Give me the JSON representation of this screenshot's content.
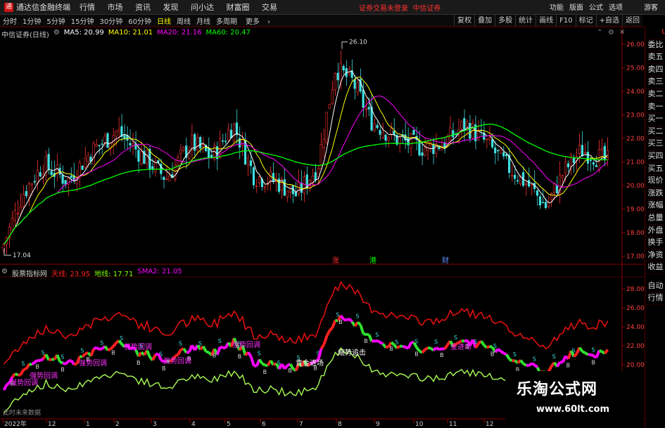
{
  "app": {
    "title": "通达信金融终端",
    "menu": [
      "行情",
      "市场",
      "资讯",
      "发现",
      "问小达",
      "财富圈",
      "交易"
    ],
    "notice": "证券交易未登录",
    "broker": "中信证券",
    "right_menu": [
      "功能",
      "版面",
      "公式",
      "选项"
    ],
    "guest": "游客"
  },
  "periods": [
    "分时",
    "1分钟",
    "5分钟",
    "15分钟",
    "30分钟",
    "60分钟",
    "日线",
    "周线",
    "月线",
    "多周期",
    "更多"
  ],
  "active_period": "日线",
  "toolbar": [
    "复权",
    "叠加",
    "多股",
    "统计",
    "画线",
    "F10",
    "标记",
    "+自选",
    "返回"
  ],
  "right_panel": [
    "委比",
    "卖五",
    "卖四",
    "卖三",
    "卖二",
    "卖一",
    "买一",
    "买二",
    "买三",
    "买四",
    "买五",
    "现价",
    "涨跌",
    "涨幅",
    "总量",
    "外盘",
    "换手",
    "净资",
    "收益"
  ],
  "right_panel_bottom": [
    "自动",
    "行情"
  ],
  "right_panel_top": "L",
  "main_chart": {
    "stock": "中信证券(日线)",
    "ma": [
      {
        "label": "MA5: 20.99",
        "color": "#ffffff"
      },
      {
        "label": "MA10: 21.01",
        "color": "#ffff00"
      },
      {
        "label": "MA20: 21.16",
        "color": "#ff00ff"
      },
      {
        "label": "MA60: 20.47",
        "color": "#00ff00"
      }
    ],
    "y_ticks": [
      "26.00",
      "25.00",
      "24.00",
      "23.00",
      "22.00",
      "21.00",
      "20.00",
      "19.00",
      "18.00",
      "17.00"
    ],
    "high_label": "26.10",
    "low_label": "17.04",
    "markers": [
      {
        "text": "涨",
        "color": "#ff3030"
      },
      {
        "text": "港",
        "color": "#00ff00"
      },
      {
        "text": "财",
        "color": "#6090ff"
      }
    ]
  },
  "indicator_chart": {
    "name": "股票指标网",
    "lines": [
      {
        "label": "天线: 23.95",
        "color": "#ff2020"
      },
      {
        "label": "地线: 17.71",
        "color": "#7fff00"
      },
      {
        "label": "SMA2: 21.05",
        "color": "#ff00ff"
      }
    ],
    "y_ticks": [
      "28.00",
      "26.00",
      "24.00",
      "22.00",
      "20.00"
    ],
    "annotations": [
      "强势回调",
      "强势回调",
      "强势回调",
      "强势回调",
      "强势回调",
      "强势回调",
      "缩势追击",
      "贵金进场",
      "金进场"
    ],
    "no_data": "此时未来数据"
  },
  "date_axis": [
    "2022年",
    "12",
    "1",
    "2",
    "3",
    "4",
    "5",
    "6",
    "7",
    "8",
    "9",
    "10",
    "11",
    "12"
  ],
  "watermark": {
    "title": "乐淘公式网",
    "url": "www.60lt.com"
  }
}
